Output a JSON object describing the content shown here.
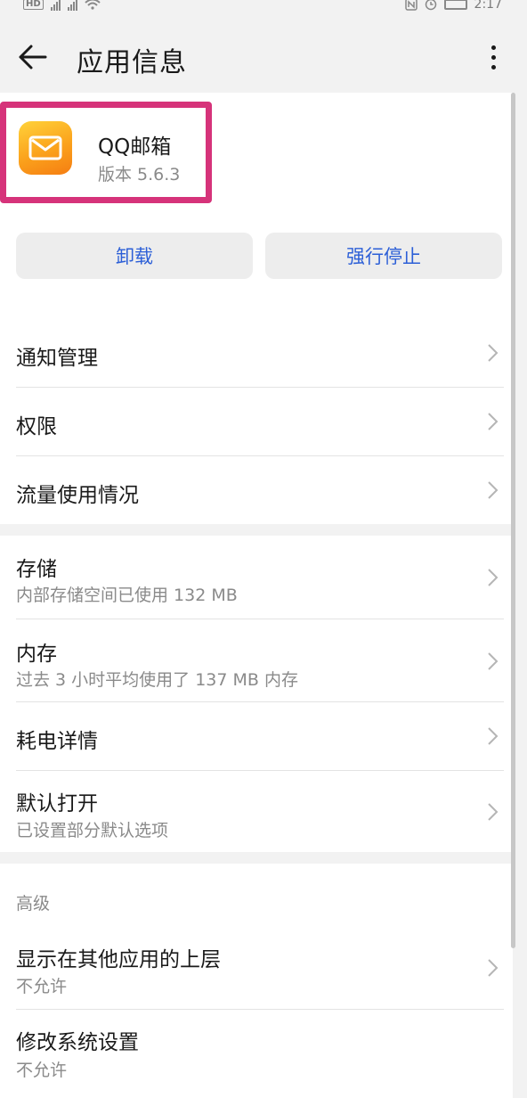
{
  "status_bar": {
    "hd": "HD",
    "time": "2:17"
  },
  "app_bar": {
    "title": "应用信息"
  },
  "app": {
    "name": "QQ邮箱",
    "version": "版本 5.6.3",
    "icon_color": "#fba21c",
    "highlight_color": "#d6337a"
  },
  "actions": {
    "uninstall": "卸载",
    "force_stop": "强行停止",
    "accent": "#2c5fd7"
  },
  "items": {
    "notification": {
      "title": "通知管理"
    },
    "permissions": {
      "title": "权限"
    },
    "data_usage": {
      "title": "流量使用情况"
    },
    "storage": {
      "title": "存储",
      "subtitle": "内部存储空间已使用 132 MB"
    },
    "memory": {
      "title": "内存",
      "subtitle": "过去 3 小时平均使用了 137 MB 内存"
    },
    "battery": {
      "title": "耗电详情"
    },
    "open_by_default": {
      "title": "默认打开",
      "subtitle": "已设置部分默认选项"
    },
    "advanced_label": "高级",
    "overlay": {
      "title": "显示在其他应用的上层",
      "subtitle": "不允许"
    },
    "modify_settings": {
      "title": "修改系统设置",
      "subtitle": "不允许"
    }
  }
}
